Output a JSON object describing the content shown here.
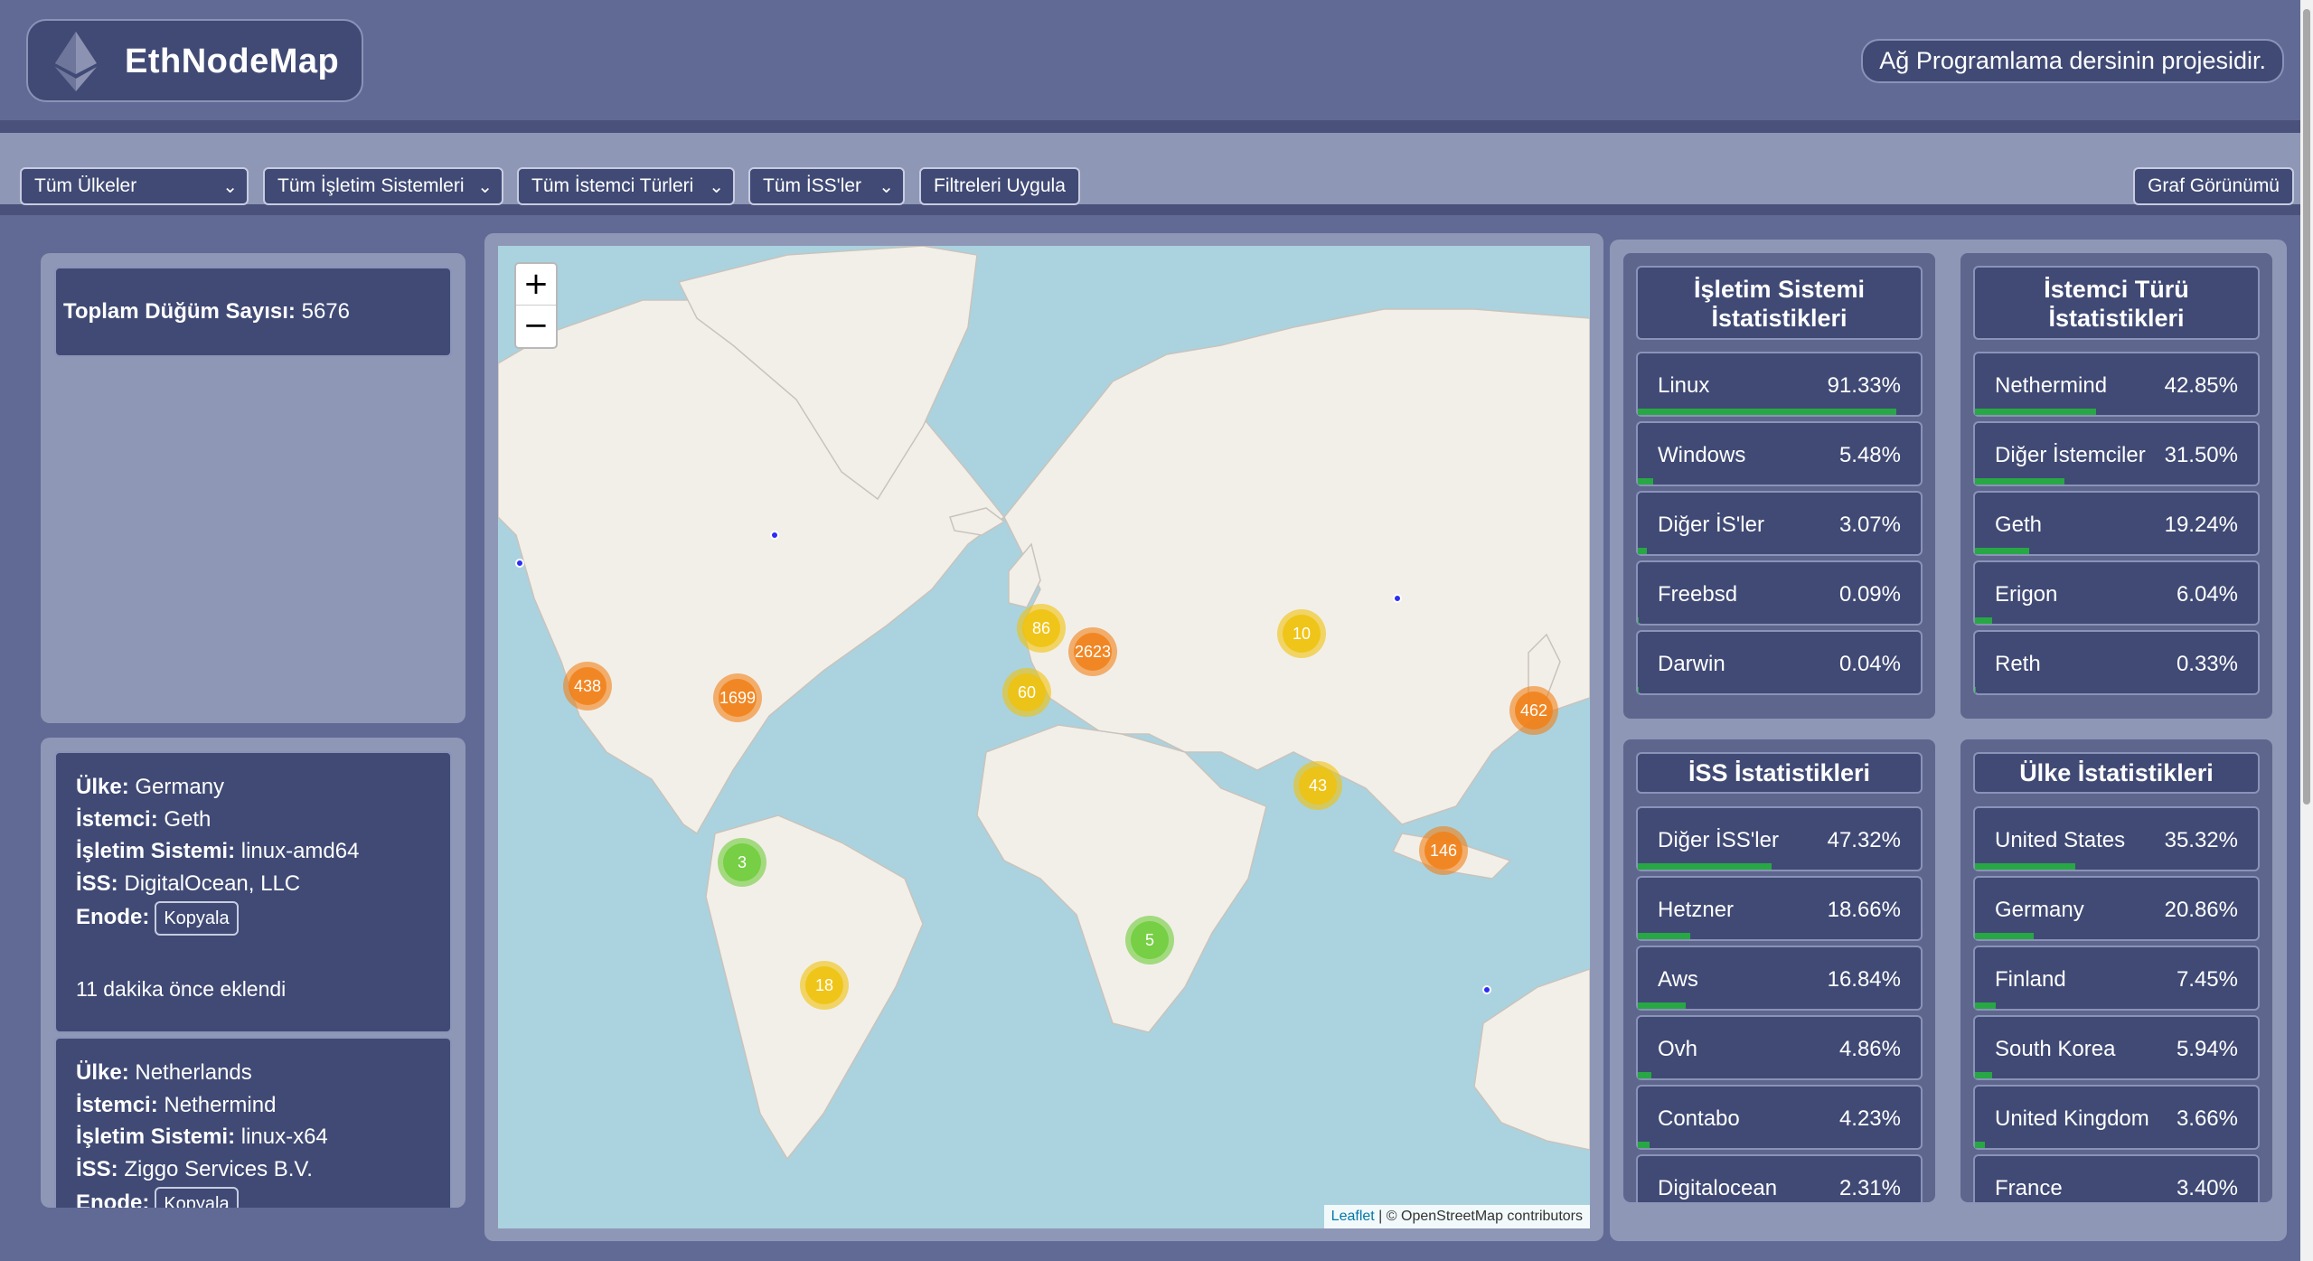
{
  "app": {
    "title": "EthNodeMap",
    "project_note": "Ağ Programlama dersinin projesidir."
  },
  "filters": {
    "country": "Tüm Ülkeler",
    "os": "Tüm İşletim Sistemleri",
    "client": "Tüm İstemci Türleri",
    "isp": "Tüm İSS'ler",
    "apply_label": "Filtreleri Uygula",
    "graph_view_label": "Graf Görünümü"
  },
  "summary": {
    "total_label": "Toplam Düğüm Sayısı:",
    "total_value": "5676"
  },
  "nodes": [
    {
      "country_label": "Ülke:",
      "country": "Germany",
      "client_label": "İstemci:",
      "client": "Geth",
      "os_label": "İşletim Sistemi:",
      "os": "linux-amd64",
      "isp_label": "İSS:",
      "isp": "DigitalOcean, LLC",
      "enode_label": "Enode:",
      "copy_label": "Kopyala",
      "added": "11 dakika önce eklendi"
    },
    {
      "country_label": "Ülke:",
      "country": "Netherlands",
      "client_label": "İstemci:",
      "client": "Nethermind",
      "os_label": "İşletim Sistemi:",
      "os": "linux-x64",
      "isp_label": "İSS:",
      "isp": "Ziggo Services B.V.",
      "enode_label": "Enode:",
      "copy_label": "Kopyala"
    }
  ],
  "map": {
    "zoom_in": "+",
    "zoom_out": "−",
    "attribution_link": "Leaflet",
    "attribution_text": "| © OpenStreetMap contributors",
    "clusters": [
      {
        "count": "438",
        "color": "orange"
      },
      {
        "count": "1699",
        "color": "orange"
      },
      {
        "count": "86",
        "color": "yellow"
      },
      {
        "count": "2623",
        "color": "orange"
      },
      {
        "count": "60",
        "color": "yellow"
      },
      {
        "count": "10",
        "color": "yellow"
      },
      {
        "count": "462",
        "color": "orange"
      },
      {
        "count": "43",
        "color": "yellow"
      },
      {
        "count": "146",
        "color": "orange"
      },
      {
        "count": "3",
        "color": "green"
      },
      {
        "count": "18",
        "color": "yellow"
      },
      {
        "count": "5",
        "color": "green"
      }
    ]
  },
  "stats": {
    "os": {
      "title": "İşletim Sistemi İstatistikleri",
      "rows": [
        {
          "label": "Linux",
          "value": "91.33%",
          "pct": 91.33
        },
        {
          "label": "Windows",
          "value": "5.48%",
          "pct": 5.48
        },
        {
          "label": "Diğer İS'ler",
          "value": "3.07%",
          "pct": 3.07
        },
        {
          "label": "Freebsd",
          "value": "0.09%",
          "pct": 0.09
        },
        {
          "label": "Darwin",
          "value": "0.04%",
          "pct": 0.04
        }
      ]
    },
    "client": {
      "title": "İstemci Türü İstatistikleri",
      "rows": [
        {
          "label": "Nethermind",
          "value": "42.85%",
          "pct": 42.85
        },
        {
          "label": "Diğer İstemciler",
          "value": "31.50%",
          "pct": 31.5
        },
        {
          "label": "Geth",
          "value": "19.24%",
          "pct": 19.24
        },
        {
          "label": "Erigon",
          "value": "6.04%",
          "pct": 6.04
        },
        {
          "label": "Reth",
          "value": "0.33%",
          "pct": 0.33
        }
      ]
    },
    "isp": {
      "title": "İSS İstatistikleri",
      "rows": [
        {
          "label": "Diğer İSS'ler",
          "value": "47.32%",
          "pct": 47.32
        },
        {
          "label": "Hetzner",
          "value": "18.66%",
          "pct": 18.66
        },
        {
          "label": "Aws",
          "value": "16.84%",
          "pct": 16.84
        },
        {
          "label": "Ovh",
          "value": "4.86%",
          "pct": 4.86
        },
        {
          "label": "Contabo",
          "value": "4.23%",
          "pct": 4.23
        },
        {
          "label": "Digitalocean",
          "value": "2.31%",
          "pct": 2.31
        }
      ]
    },
    "country": {
      "title": "Ülke İstatistikleri",
      "rows": [
        {
          "label": "United States",
          "value": "35.32%",
          "pct": 35.32
        },
        {
          "label": "Germany",
          "value": "20.86%",
          "pct": 20.86
        },
        {
          "label": "Finland",
          "value": "7.45%",
          "pct": 7.45
        },
        {
          "label": "South Korea",
          "value": "5.94%",
          "pct": 5.94
        },
        {
          "label": "United Kingdom",
          "value": "3.66%",
          "pct": 3.66
        },
        {
          "label": "France",
          "value": "3.40%",
          "pct": 3.4
        }
      ]
    }
  }
}
